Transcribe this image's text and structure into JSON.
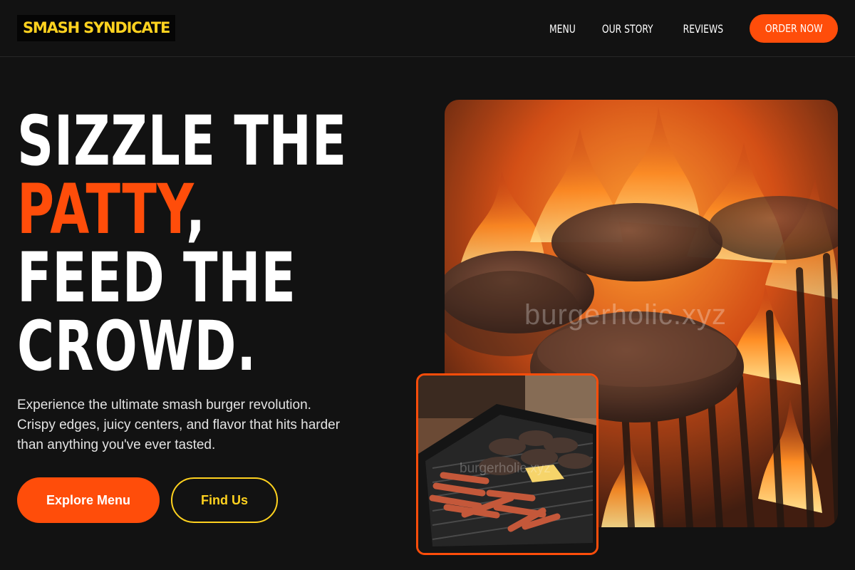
{
  "brand": {
    "name": "SMASH SYNDICATE"
  },
  "nav": {
    "links": [
      "MENU",
      "OUR STORY",
      "REVIEWS"
    ],
    "cta": "ORDER NOW"
  },
  "hero": {
    "headline": {
      "line1": "SIZZLE THE",
      "line2_accent": "PATTY",
      "line2_rest": ",",
      "line3": "FEED THE",
      "line4": "CROWD."
    },
    "description_lines": [
      "Experience the ultimate smash burger revolution.",
      "Crispy edges, juicy centers, and flavor that hits harder",
      "than anything you've ever tasted."
    ],
    "primary_button": "Explore Menu",
    "secondary_button": "Find Us"
  },
  "images": {
    "main_watermark": "burgerholic.xyz",
    "inset_watermark": "burgerholic.xyz"
  },
  "colors": {
    "background": "#121212",
    "accent_orange": "#ff4d0a",
    "accent_yellow": "#ffd21f"
  }
}
